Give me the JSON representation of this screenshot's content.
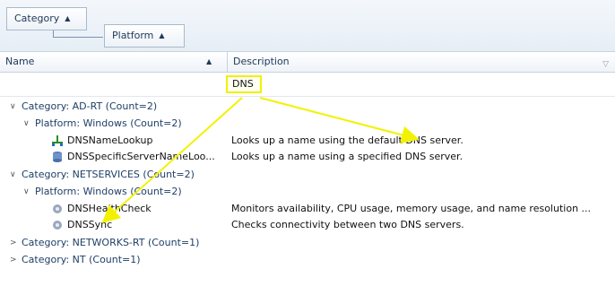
{
  "group_panel": {
    "chips": [
      {
        "label": "Category"
      },
      {
        "label": "Platform"
      }
    ]
  },
  "columns": {
    "name": "Name",
    "description": "Description"
  },
  "filter": {
    "value": "DNS"
  },
  "tree": {
    "rows": [
      {
        "text": "Category: AD-RT (Count=2)"
      },
      {
        "text": "Platform: Windows (Count=2)"
      },
      {
        "name": "DNSNameLookup",
        "description": "Looks up a name using the default DNS server."
      },
      {
        "name": "DNSSpecificServerNameLoo...",
        "description": "Looks up a name using a specified DNS server."
      },
      {
        "text": "Category: NETSERVICES (Count=2)"
      },
      {
        "text": "Platform: Windows (Count=2)"
      },
      {
        "name": "DNSHealthCheck",
        "description": "Monitors availability, CPU usage, memory usage, and name resolution ..."
      },
      {
        "name": "DNSSync",
        "description": "Checks connectivity between two DNS servers."
      },
      {
        "text": "Category: NETWORKS-RT (Count=1)"
      },
      {
        "text": "Category: NT (Count=1)"
      }
    ]
  },
  "colors": {
    "highlight": "#f2f200",
    "header_text": "#203a5a"
  }
}
